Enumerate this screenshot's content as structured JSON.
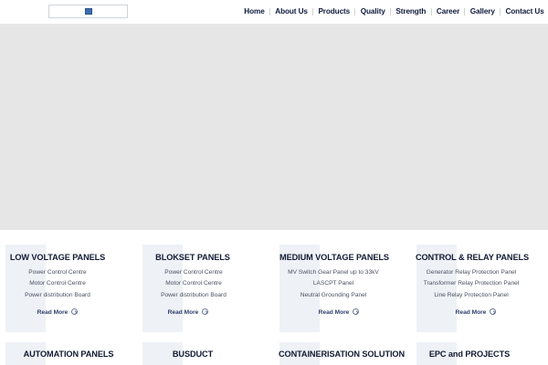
{
  "nav": {
    "items": [
      "Home",
      "About Us",
      "Products",
      "Quality",
      "Strength",
      "Career",
      "Gallery",
      "Contact Us"
    ]
  },
  "cards": [
    {
      "title": "LOW VOLTAGE PANELS",
      "items": [
        "Power Control Centre",
        "Motor Control Centre",
        "Power distribution Board"
      ],
      "read_more": "Read More"
    },
    {
      "title": "BLOKSET PANELS",
      "items": [
        "Power Control Centre",
        "Motor Control Centre",
        "Power distribution Board"
      ],
      "read_more": "Read More"
    },
    {
      "title": "MEDIUM VOLTAGE PANELS",
      "items": [
        "MV Switch Gear Panel up to 33kV",
        "LASCPT Panel",
        "Neutral Grounding Panel"
      ],
      "read_more": "Read More"
    },
    {
      "title": "CONTROL & RELAY PANELS",
      "items": [
        "Generator Relay Protection Panel",
        "Transformer Relay Protection Panel",
        "Line Relay Protection Panel"
      ],
      "read_more": "Read More"
    },
    {
      "title": "AUTOMATION PANELS"
    },
    {
      "title": "BUSDUCT"
    },
    {
      "title": "CONTAINERISATION SOLUTION"
    },
    {
      "title": "EPC and PROJECTS"
    }
  ],
  "colors": {
    "hero_background": "#e6e6e6",
    "card_accent": "#eef1f6",
    "nav_text": "#0f1b3d"
  },
  "icons": {
    "logo": "company-logo",
    "read_more": "circle-arrow-right-icon"
  }
}
